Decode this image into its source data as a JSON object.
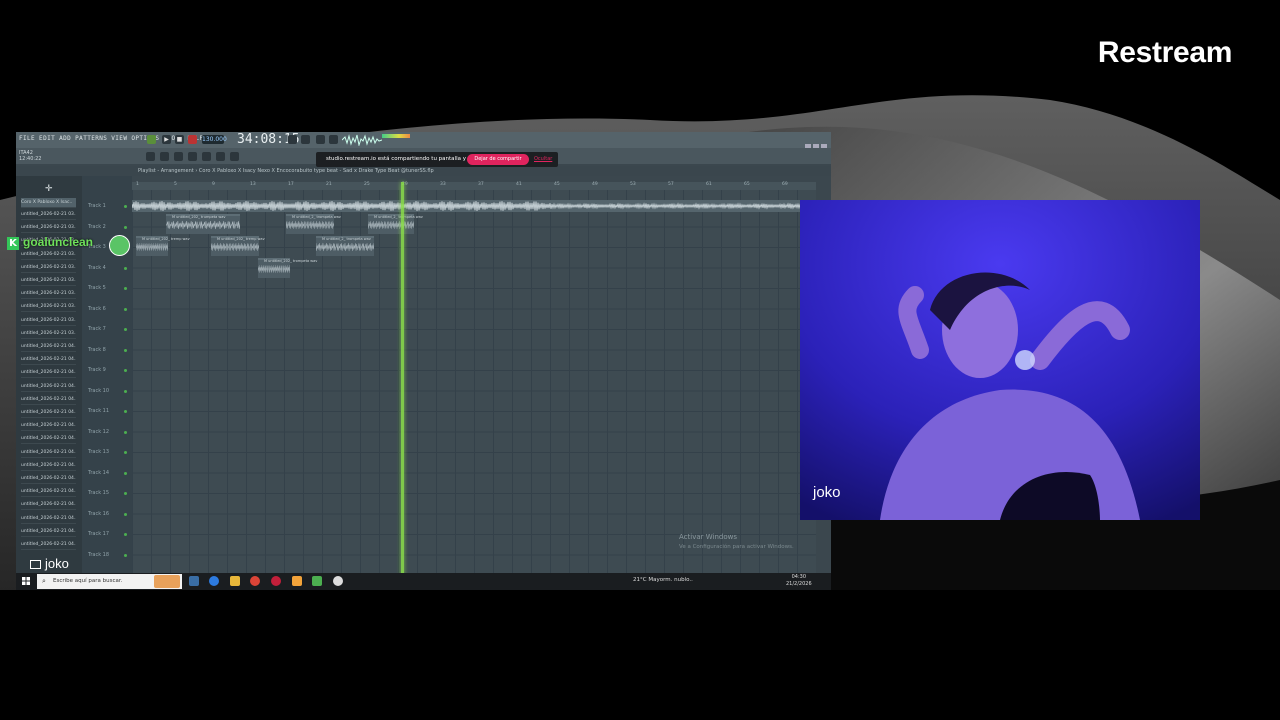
{
  "brand": {
    "name": "Restream"
  },
  "fl": {
    "menu": "FILE EDIT ADD PATTERNS VIEW OPTIONS TOOLS HELP",
    "time": "34:08:15",
    "tempo": "130.000",
    "info_line1": "ITA42",
    "info_line2": "12:40:22",
    "playlist_title": "Playlist - Arrangement › Coro X Pabloxo X Isacy Nexo X Encocorabuito type beat - Sad x Drake Type Beat @tunerSS.flp",
    "browser_header": "Coro X Pabloxo X Isac..",
    "browser_items": [
      "untitled_2026-02-21 03..",
      "untitled_2026-02-21 03..",
      "untitled_2026-02-21 03..",
      "untitled_2026-02-21 03..",
      "untitled_2026-02-21 03..",
      "untitled_2026-02-21 03..",
      "untitled_2026-02-21 03..",
      "untitled_2026-02-21 03..",
      "untitled_2026-02-21 03..",
      "untitled_2026-02-21 03..",
      "untitled_2026-02-21 04..",
      "untitled_2026-02-21 04..",
      "untitled_2026-02-21 04..",
      "untitled_2026-02-21 04..",
      "untitled_2026-02-21 04..",
      "untitled_2026-02-21 04..",
      "untitled_2026-02-21 04..",
      "untitled_2026-02-21 04..",
      "untitled_2026-02-21 04..",
      "untitled_2026-02-21 04..",
      "untitled_2026-02-21 04..",
      "untitled_2026-02-21 04..",
      "untitled_2026-02-21 04..",
      "untitled_2026-02-21 04..",
      "untitled_2026-02-21 04..",
      "untitled_2026-02-21 04.."
    ],
    "tracks": [
      "Track 1",
      "Track 2",
      "Track 3",
      "Track 4",
      "Track 5",
      "Track 6",
      "Track 7",
      "Track 8",
      "Track 9",
      "Track 10",
      "Track 11",
      "Track 12",
      "Track 13",
      "Track 14",
      "Track 15",
      "Track 16",
      "Track 17",
      "Track 18"
    ],
    "ruler": [
      "1",
      "5",
      "9",
      "13",
      "17",
      "21",
      "25",
      "29",
      "33",
      "37",
      "41",
      "45",
      "49",
      "53",
      "57",
      "61",
      "65",
      "69"
    ],
    "clips": [
      {
        "label": "M untitled_202_ trumpeta wav"
      },
      {
        "label": "M untitled_2_ trompeta wav"
      },
      {
        "label": "M untitled_2_ trompeta wav"
      },
      {
        "label": "M untitled_202_ tremp wav"
      },
      {
        "label": "M untitled_202_ tremp wav"
      },
      {
        "label": "M untitled_2_ trompeta wav"
      },
      {
        "label": "M untitled_202_ trompeta wav"
      }
    ],
    "activate_title": "Activar Windows",
    "activate_sub": "Ve a Configuración para activar Windows."
  },
  "share_bar": {
    "text": "studio.restream.io está compartiendo tu pantalla y audio.",
    "stop_label": "Dejar de compartir",
    "hide_label": "Ocultar"
  },
  "taskbar": {
    "search_placeholder": "Escribe aquí para buscar.",
    "weather": "21°C  Mayorm. nublo..",
    "clock_time": "04:30",
    "clock_date": "21/2/2026"
  },
  "chat": {
    "username": "goalunclean"
  },
  "screen_label": "joko",
  "camera": {
    "name": "joko"
  },
  "colors": {
    "accent": "#e0245e",
    "playhead": "#8be04a",
    "camera_light": "#3a2bd8"
  }
}
